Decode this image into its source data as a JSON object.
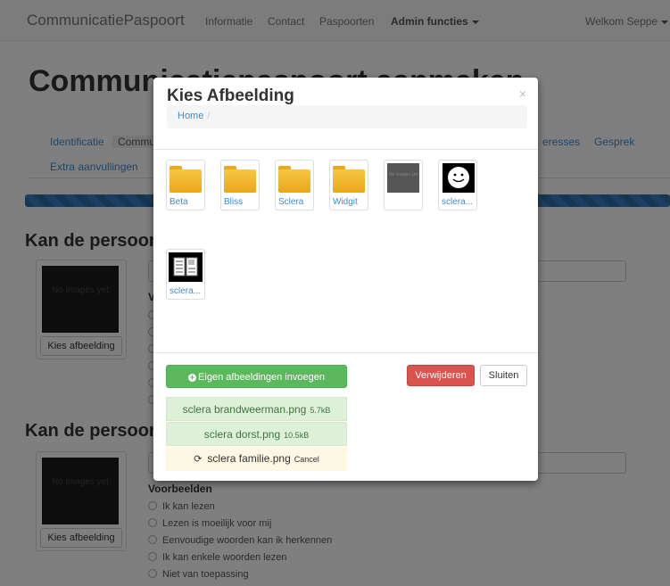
{
  "navbar": {
    "brand": "CommunicatiePaspoort",
    "links": [
      "Informatie",
      "Contact",
      "Paspoorten"
    ],
    "admin": "Admin functies",
    "user": "Welkom Seppe"
  },
  "page": {
    "title": "Communicatiepaspoort aanmaken",
    "tabs": [
      "Identificatie",
      "Commu",
      "eresses",
      "Gesprek",
      "Extra aanvullingen"
    ],
    "section1": "Kan de persoon",
    "section2": "Kan de persoon",
    "no_image": "No images yet",
    "choose_image": "Kies afbeelding",
    "initial_v": "V",
    "examples_label": "Voorbeelden",
    "options": [
      "Ik kan lezen",
      "Lezen is moeilijk voor mij",
      "Eenvoudige woorden kan ik herkennen",
      "Ik kan enkele woorden lezen",
      "Niet van toepassing"
    ]
  },
  "modal": {
    "title": "Kies Afbeelding",
    "close": "×",
    "breadcrumb": "Home",
    "breadcrumb_sep": "/",
    "folders": [
      "Beta",
      "Bliss",
      "Sclera",
      "Widgit"
    ],
    "images": [
      "sclera...",
      "sclera..."
    ],
    "no_images": "No images yet",
    "add_button": "Eigen afbeeldingen invoegen",
    "delete_button": "Verwijderen",
    "close_button": "Sluiten",
    "uploads": [
      {
        "name": "sclera brandweerman.png",
        "size": "5.7kB"
      },
      {
        "name": "sclera dorst.png",
        "size": "10.5kB"
      },
      {
        "name": "sclera familie.png",
        "action": "Cancel"
      }
    ]
  },
  "colors": {
    "primary": "#428bca",
    "success": "#5cb85c",
    "danger": "#d9534f",
    "folder": "#f0b429"
  }
}
